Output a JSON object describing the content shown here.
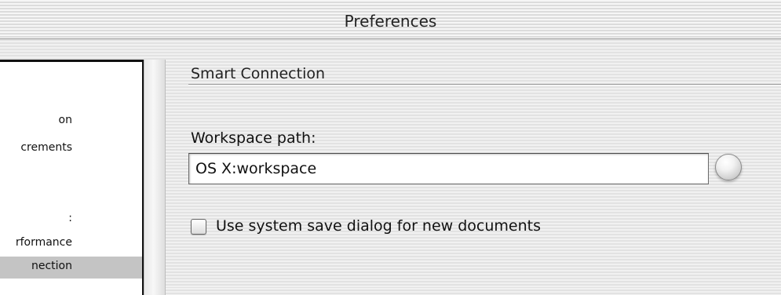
{
  "window": {
    "title": "Preferences"
  },
  "sidebar": {
    "items": [
      {
        "label": "on",
        "selected": false
      },
      {
        "label": "crements",
        "selected": false
      },
      {
        "label": ":",
        "selected": false
      },
      {
        "label": "rformance",
        "selected": false
      },
      {
        "label": "nection",
        "selected": true
      }
    ]
  },
  "panel": {
    "section_title": "Smart Connection",
    "workspace_label": "Workspace path:",
    "workspace_value": "OS X:workspace",
    "save_dialog_label": "Use system save dialog for new documents",
    "save_dialog_checked": false
  },
  "icons": {
    "browse": "browse-circle-icon",
    "checkbox": "checkbox-unchecked-icon"
  },
  "colors": {
    "selection": "#c4c4c4",
    "list_border": "#111111",
    "stripe_light": "#f1f1f1",
    "stripe_dark": "#e2e2e2"
  }
}
